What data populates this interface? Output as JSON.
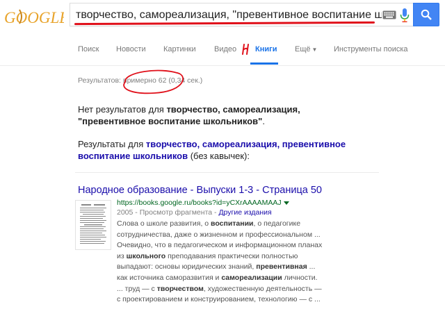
{
  "logo": {
    "text": "GOOGLE"
  },
  "search": {
    "query": "творчество, самореализация, \"превентивное воспитание школьник"
  },
  "tabs": [
    {
      "label": "Поиск"
    },
    {
      "label": "Новости"
    },
    {
      "label": "Картинки"
    },
    {
      "label": "Видео"
    },
    {
      "label": "Книги"
    },
    {
      "label": "Ещё"
    },
    {
      "label": "Инструменты поиска"
    }
  ],
  "stats": "Результатов: примерно 62 (0,34 сек.)",
  "no_results": {
    "prefix": "Нет результатов для ",
    "query_bold": "творчество, самореализация, \"превентивное воспитание школьников\"",
    "suffix": "."
  },
  "results_for": {
    "prefix": "Результаты для ",
    "link": "творчество, самореализация, превентивное воспитание школьников",
    "suffix": " (без кавычек):"
  },
  "result": {
    "title": "Народное образование - Выпуски 1-3 - Страница 50",
    "url": "https://books.google.ru/books?id=yCXrAAAAMAAJ",
    "meta_text": "2005 - Просмотр фрагмента - ",
    "meta_link": "Другие издания",
    "snippet_parts": [
      {
        "t": "Слова о школе развития, о "
      },
      {
        "t": "воспитании",
        "b": true
      },
      {
        "t": ", о педагогике сотрудничества, даже о жизненном и профессиональном ... Очевидно, что в педагогическом и информационном планах из "
      },
      {
        "t": "школьного",
        "b": true
      },
      {
        "t": " преподавания практически полностью выпадают: основы юридических знаний, "
      },
      {
        "t": "превентивная",
        "b": true
      },
      {
        "t": " ... как источника саморазвития и "
      },
      {
        "t": "самореализации",
        "b": true
      },
      {
        "t": " личности. ... труд — с "
      },
      {
        "t": "творчеством",
        "b": true
      },
      {
        "t": ", художественную деятельность — с проектированием и конструированием, технологию — с ..."
      }
    ]
  },
  "colors": {
    "accent": "#1a73e8",
    "link": "#1a0dab",
    "url": "#006621",
    "annotation": "#e0101a",
    "search_button": "#4285f4"
  }
}
